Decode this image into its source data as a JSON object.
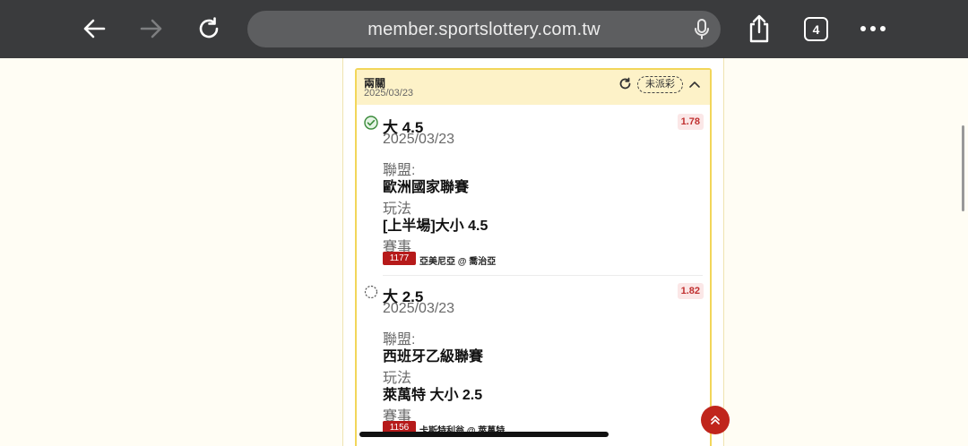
{
  "browser": {
    "url": "member.sportslottery.com.tw",
    "tab_count": "4"
  },
  "card": {
    "title": "兩關",
    "date": "2025/03/23",
    "status": "未派彩"
  },
  "selections": [
    {
      "name": "大 4.5",
      "date": "2025/03/23",
      "odds": "1.78",
      "league_label": "聯盟:",
      "league": "歐洲國家聯賽",
      "play_label": "玩法",
      "play": "[上半場]大小 4.5",
      "event_label": "賽事",
      "match_no": "1177",
      "match": "亞美尼亞 @ 喬治亞",
      "state": "won"
    },
    {
      "name": "大 2.5",
      "date": "2025/03/23",
      "odds": "1.82",
      "league_label": "聯盟:",
      "league": "西班牙乙級聯賽",
      "play_label": "玩法",
      "play": "萊萬特 大小 2.5",
      "event_label": "賽事",
      "match_no": "1156",
      "match": "卡斯特利翁 @ 萊萬特",
      "state": "pending"
    }
  ],
  "colors": {
    "accent": "#f2d65a",
    "header_bg": "#fdf2c8",
    "badge_red": "#b61a1a",
    "odds_text": "#c03030"
  },
  "icons": [
    "back-icon",
    "forward-icon",
    "reload-icon",
    "mic-icon",
    "share-icon",
    "more-icon",
    "refresh-icon",
    "chevron-up-icon",
    "check-circle-icon",
    "pending-circle-icon",
    "scroll-top-icon"
  ]
}
